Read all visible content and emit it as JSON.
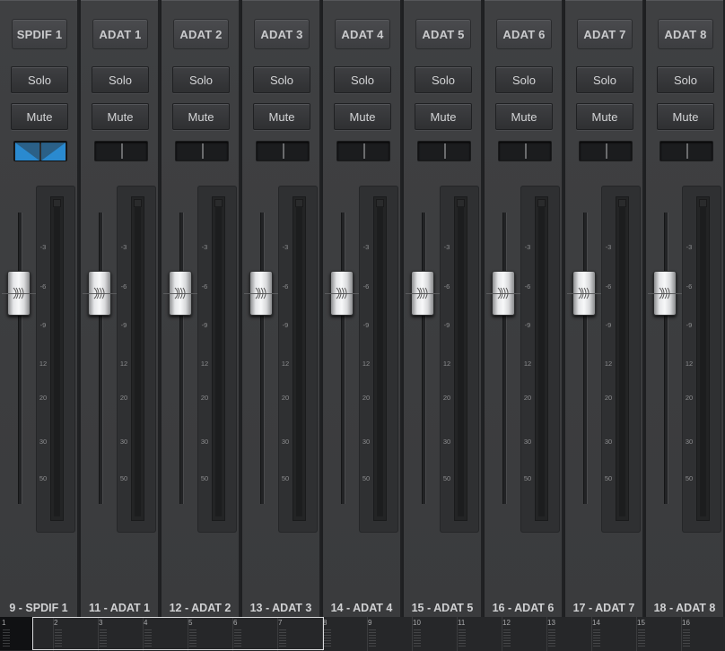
{
  "channels": [
    {
      "name": "SPDIF 1",
      "label": "9 - SPDIF 1",
      "solo": "Solo",
      "mute": "Mute",
      "linked": true
    },
    {
      "name": "ADAT 1",
      "label": "11 - ADAT 1",
      "solo": "Solo",
      "mute": "Mute",
      "linked": false
    },
    {
      "name": "ADAT 2",
      "label": "12 - ADAT 2",
      "solo": "Solo",
      "mute": "Mute",
      "linked": false
    },
    {
      "name": "ADAT 3",
      "label": "13 - ADAT 3",
      "solo": "Solo",
      "mute": "Mute",
      "linked": false
    },
    {
      "name": "ADAT 4",
      "label": "14 - ADAT 4",
      "solo": "Solo",
      "mute": "Mute",
      "linked": false
    },
    {
      "name": "ADAT 5",
      "label": "15 - ADAT 5",
      "solo": "Solo",
      "mute": "Mute",
      "linked": false
    },
    {
      "name": "ADAT 6",
      "label": "16 - ADAT 6",
      "solo": "Solo",
      "mute": "Mute",
      "linked": false
    },
    {
      "name": "ADAT 7",
      "label": "17 - ADAT 7",
      "solo": "Solo",
      "mute": "Mute",
      "linked": false
    },
    {
      "name": "ADAT 8",
      "label": "18 - ADAT 8",
      "solo": "Solo",
      "mute": "Mute",
      "linked": false
    }
  ],
  "meter_scale": [
    "-3",
    "-6",
    "-9",
    "12",
    "20",
    "30",
    "50"
  ],
  "overview": {
    "numbers": [
      "1",
      "2",
      "3",
      "4",
      "5",
      "6",
      "7",
      "8",
      "9",
      "10",
      "11",
      "12",
      "13",
      "14",
      "15",
      "16"
    ]
  },
  "colors": {
    "link_active": "#2a8ad0",
    "strip_bg": "#3c3d3f"
  }
}
